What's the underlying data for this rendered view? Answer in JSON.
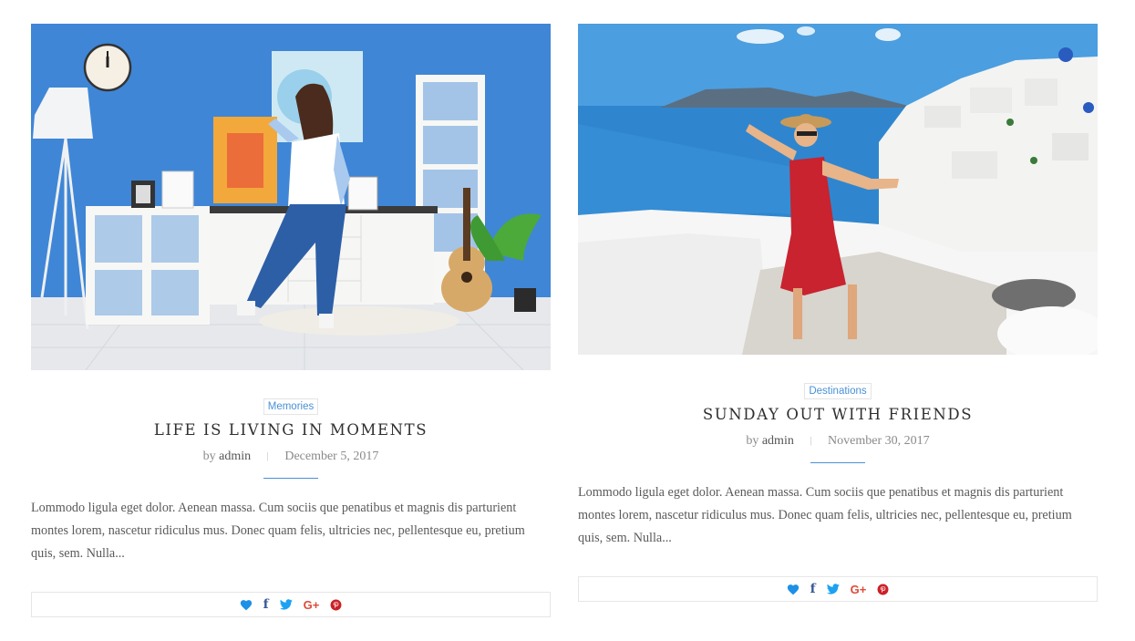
{
  "posts": [
    {
      "image_alt": "Woman dancing with headphones in a blue living room",
      "category": "Memories",
      "title": "LIFE IS LIVING IN MOMENTS",
      "by": "by",
      "author": "admin",
      "separator": "|",
      "date": "December 5, 2017",
      "excerpt": "Lommodo ligula eget dolor. Aenean massa. Cum sociis que penatibus et magnis dis parturient montes lorem, nascetur ridiculus mus. Donec quam felis, ultricies nec, pellentesque eu, pretium quis, sem. Nulla..."
    },
    {
      "image_alt": "Woman in red dress on white stairs in Santorini",
      "category": "Destinations",
      "title": "SUNDAY OUT WITH FRIENDS",
      "by": "by",
      "author": "admin",
      "separator": "|",
      "date": "November 30, 2017",
      "excerpt": "Lommodo ligula eget dolor. Aenean massa. Cum sociis que penatibus et magnis dis parturient montes lorem, nascetur ridiculus mus. Donec quam felis, ultricies nec, pellentesque eu, pretium quis, sem. Nulla..."
    }
  ],
  "share": {
    "icons": [
      "heart-icon",
      "facebook-icon",
      "twitter-icon",
      "google-plus-icon",
      "pinterest-icon"
    ],
    "facebook_glyph": "f",
    "google_plus_glyph": "G+"
  },
  "colors": {
    "accent": "#4a90d6",
    "heart": "#1e90e6",
    "facebook": "#3b5998",
    "twitter": "#1da1f2",
    "google_plus": "#dd4b39",
    "pinterest": "#cb2027"
  }
}
